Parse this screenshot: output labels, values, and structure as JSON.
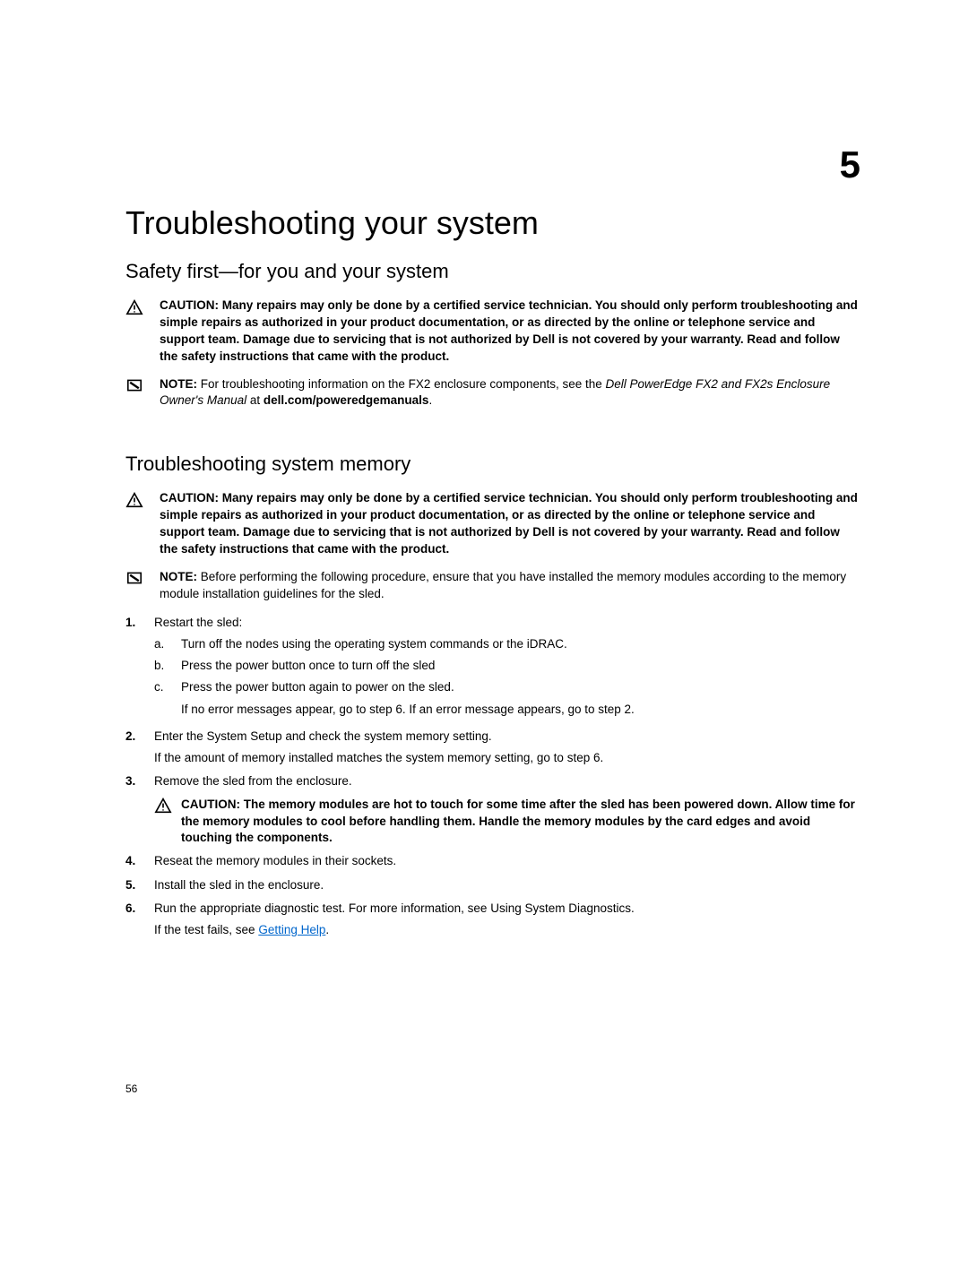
{
  "chapter": {
    "number": "5",
    "title": "Troubleshooting your system"
  },
  "section1": {
    "heading": "Safety first—for you and your system",
    "caution": {
      "label": "CAUTION: ",
      "text": "Many repairs may only be done by a certified service technician. You should only perform troubleshooting and simple repairs as authorized in your product documentation, or as directed by the online or telephone service and support team. Damage due to servicing that is not authorized by Dell is not covered by your warranty. Read and follow the safety instructions that came with the product."
    },
    "note": {
      "label": "NOTE: ",
      "pre": "For troubleshooting information on the FX2 enclosure components, see the ",
      "italic": "Dell PowerEdge FX2 and FX2s Enclosure Owner's Manual",
      "mid": " at ",
      "bold": "dell.com/poweredgemanuals",
      "post": "."
    }
  },
  "section2": {
    "heading": "Troubleshooting system memory",
    "caution": {
      "label": "CAUTION: ",
      "text": "Many repairs may only be done by a certified service technician. You should only perform troubleshooting and simple repairs as authorized in your product documentation, or as directed by the online or telephone service and support team. Damage due to servicing that is not authorized by Dell is not covered by your warranty. Read and follow the safety instructions that came with the product."
    },
    "note": {
      "label": "NOTE: ",
      "text": "Before performing the following procedure, ensure that you have installed the memory modules according to the memory module installation guidelines for the sled."
    },
    "steps": {
      "s1": {
        "num": "1.",
        "text": "Restart the sled:",
        "a": {
          "num": "a.",
          "text": "Turn off the nodes using the operating system commands or the iDRAC."
        },
        "b": {
          "num": "b.",
          "text": "Press the power button once to turn off the sled"
        },
        "c": {
          "num": "c.",
          "text": "Press the power button again to power on the sled."
        },
        "c_sub": "If no error messages appear, go to step 6. If an error message appears, go to step 2."
      },
      "s2": {
        "num": "2.",
        "text": "Enter the System Setup and check the system memory setting.",
        "sub": "If the amount of memory installed matches the system memory setting, go to step 6."
      },
      "s3": {
        "num": "3.",
        "text": "Remove the sled from the enclosure.",
        "caution": {
          "label": "CAUTION: ",
          "text": "The memory modules are hot to touch for some time after the sled has been powered down. Allow time for the memory modules to cool before handling them. Handle the memory modules by the card edges and avoid touching the components."
        }
      },
      "s4": {
        "num": "4.",
        "text": "Reseat the memory modules in their sockets."
      },
      "s5": {
        "num": "5.",
        "text": "Install the sled in the enclosure."
      },
      "s6": {
        "num": "6.",
        "text": "Run the appropriate diagnostic test. For more information, see Using System Diagnostics.",
        "sub_pre": "If the test fails, see ",
        "sub_link": "Getting Help",
        "sub_post": "."
      }
    }
  },
  "page_number": "56"
}
